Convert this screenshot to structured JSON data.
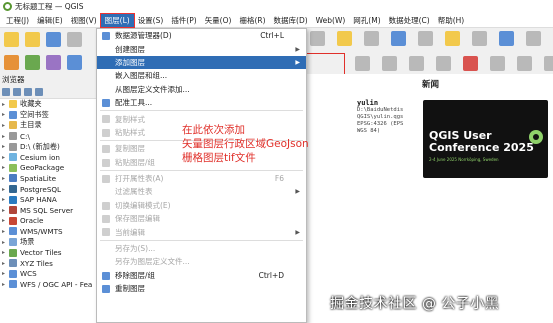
{
  "window": {
    "title": "无标题工程 — QGIS",
    "app_icon": "qgis-logo-icon"
  },
  "menubar": {
    "items": [
      "工程(J)",
      "编辑(E)",
      "视图(V)",
      "图层(L)",
      "设置(S)",
      "插件(P)",
      "矢量(O)",
      "栅格(R)",
      "数据库(D)",
      "Web(W)",
      "网孔(M)",
      "数据处理(C)",
      "帮助(H)"
    ],
    "active_index": 3
  },
  "layer_menu": {
    "items": [
      {
        "label": "数据源管理器(D)",
        "shortcut": "Ctrl+L",
        "icon": "data-source-icon",
        "disabled": false
      },
      {
        "label": "创建图层",
        "shortcut": "",
        "submenu": true,
        "disabled": false
      },
      {
        "label": "添加图层",
        "shortcut": "",
        "submenu": true,
        "active": true,
        "disabled": false
      },
      {
        "label": "嵌入图层和组...",
        "shortcut": "",
        "disabled": false
      },
      {
        "label": "从图层定义文件添加...",
        "shortcut": "",
        "disabled": false
      },
      {
        "label": "配准工具...",
        "shortcut": "",
        "icon": "georeferencer-icon",
        "disabled": false
      },
      {
        "sep": true
      },
      {
        "label": "复制样式",
        "shortcut": "",
        "icon": "copy-style-icon",
        "disabled": true
      },
      {
        "label": "粘贴样式",
        "shortcut": "",
        "icon": "paste-style-icon",
        "disabled": true
      },
      {
        "sep": true
      },
      {
        "label": "复制图层",
        "shortcut": "",
        "icon": "copy-layer-icon",
        "disabled": true
      },
      {
        "label": "粘贴图层/组",
        "shortcut": "",
        "icon": "paste-layer-icon",
        "disabled": true
      },
      {
        "sep": true
      },
      {
        "label": "打开属性表(A)",
        "shortcut": "F6",
        "icon": "attribute-table-icon",
        "disabled": true
      },
      {
        "label": "过滤属性表",
        "shortcut": "",
        "submenu": true,
        "disabled": true
      },
      {
        "label": "切换编辑模式(E)",
        "shortcut": "",
        "icon": "toggle-edit-icon",
        "disabled": true
      },
      {
        "label": "保存图层编辑",
        "shortcut": "",
        "icon": "save-edits-icon",
        "disabled": true
      },
      {
        "label": "当前编辑",
        "shortcut": "",
        "icon": "current-edits-icon",
        "submenu": true,
        "disabled": true
      },
      {
        "sep": true
      },
      {
        "label": "另存为(S)...",
        "shortcut": "",
        "disabled": true
      },
      {
        "label": "另存为图层定义文件...",
        "shortcut": "",
        "disabled": true
      },
      {
        "label": "移除图层/组",
        "shortcut": "Ctrl+D",
        "icon": "remove-layer-icon",
        "disabled": false
      },
      {
        "label": "重制图层",
        "shortcut": "",
        "icon": "duplicate-layer-icon",
        "disabled": false
      }
    ]
  },
  "browser_panel": {
    "title": "浏览器",
    "items": [
      {
        "label": "收藏夹",
        "icon": "star-icon",
        "color": "#f2c94c"
      },
      {
        "label": "空间书签",
        "icon": "bookmark-icon",
        "color": "#5b8fd6"
      },
      {
        "label": "主目录",
        "icon": "home-folder-icon",
        "color": "#e6b84c"
      },
      {
        "label": "C:\\",
        "icon": "drive-icon",
        "color": "#999999"
      },
      {
        "label": "D:\\ (新加卷)",
        "icon": "drive-icon",
        "color": "#999999"
      },
      {
        "label": "Cesium ion",
        "icon": "cesium-icon",
        "color": "#6fb3e0"
      },
      {
        "label": "GeoPackage",
        "icon": "geopackage-icon",
        "color": "#8bbf5a"
      },
      {
        "label": "SpatiaLite",
        "icon": "spatialite-icon",
        "color": "#4a7cc2"
      },
      {
        "label": "PostgreSQL",
        "icon": "postgresql-icon",
        "color": "#336791"
      },
      {
        "label": "SAP HANA",
        "icon": "sap-hana-icon",
        "color": "#2a7bc0"
      },
      {
        "label": "MS SQL Server",
        "icon": "mssql-icon",
        "color": "#b0463a"
      },
      {
        "label": "Oracle",
        "icon": "oracle-icon",
        "color": "#c74634"
      },
      {
        "label": "WMS/WMTS",
        "icon": "wms-icon",
        "color": "#5b8fd6"
      },
      {
        "label": "场景",
        "icon": "scene-icon",
        "color": "#7aa5d6"
      },
      {
        "label": "Vector Tiles",
        "icon": "vector-tiles-icon",
        "color": "#6aa84f"
      },
      {
        "label": "XYZ Tiles",
        "icon": "xyz-tiles-icon",
        "color": "#6d8fb8"
      },
      {
        "label": "WCS",
        "icon": "wcs-icon",
        "color": "#5b8fd6"
      },
      {
        "label": "WFS / OGC API - Fea",
        "icon": "wfs-icon",
        "color": "#5b8fd6"
      }
    ]
  },
  "annotation": {
    "lines": [
      "在此依次添加",
      "矢量图层行政区域GeoJson",
      "栅格图层tif文件"
    ],
    "color": "#e0302a"
  },
  "welcome": {
    "news_title": "新闻",
    "project": {
      "name": "yulin",
      "path_lines": [
        "D:\\BaiduNetdis",
        "QGIS\\yulin.qgs",
        "EPSG:4326 (EPS",
        "WGS 84)"
      ]
    },
    "news_card": {
      "title_line1": "QGIS User",
      "title_line2": "Conference 2025",
      "subtitle": "2-4 June 2025 Norrköping, Sweden"
    }
  },
  "watermark": "掘金技术社区 @ 公子小黑"
}
